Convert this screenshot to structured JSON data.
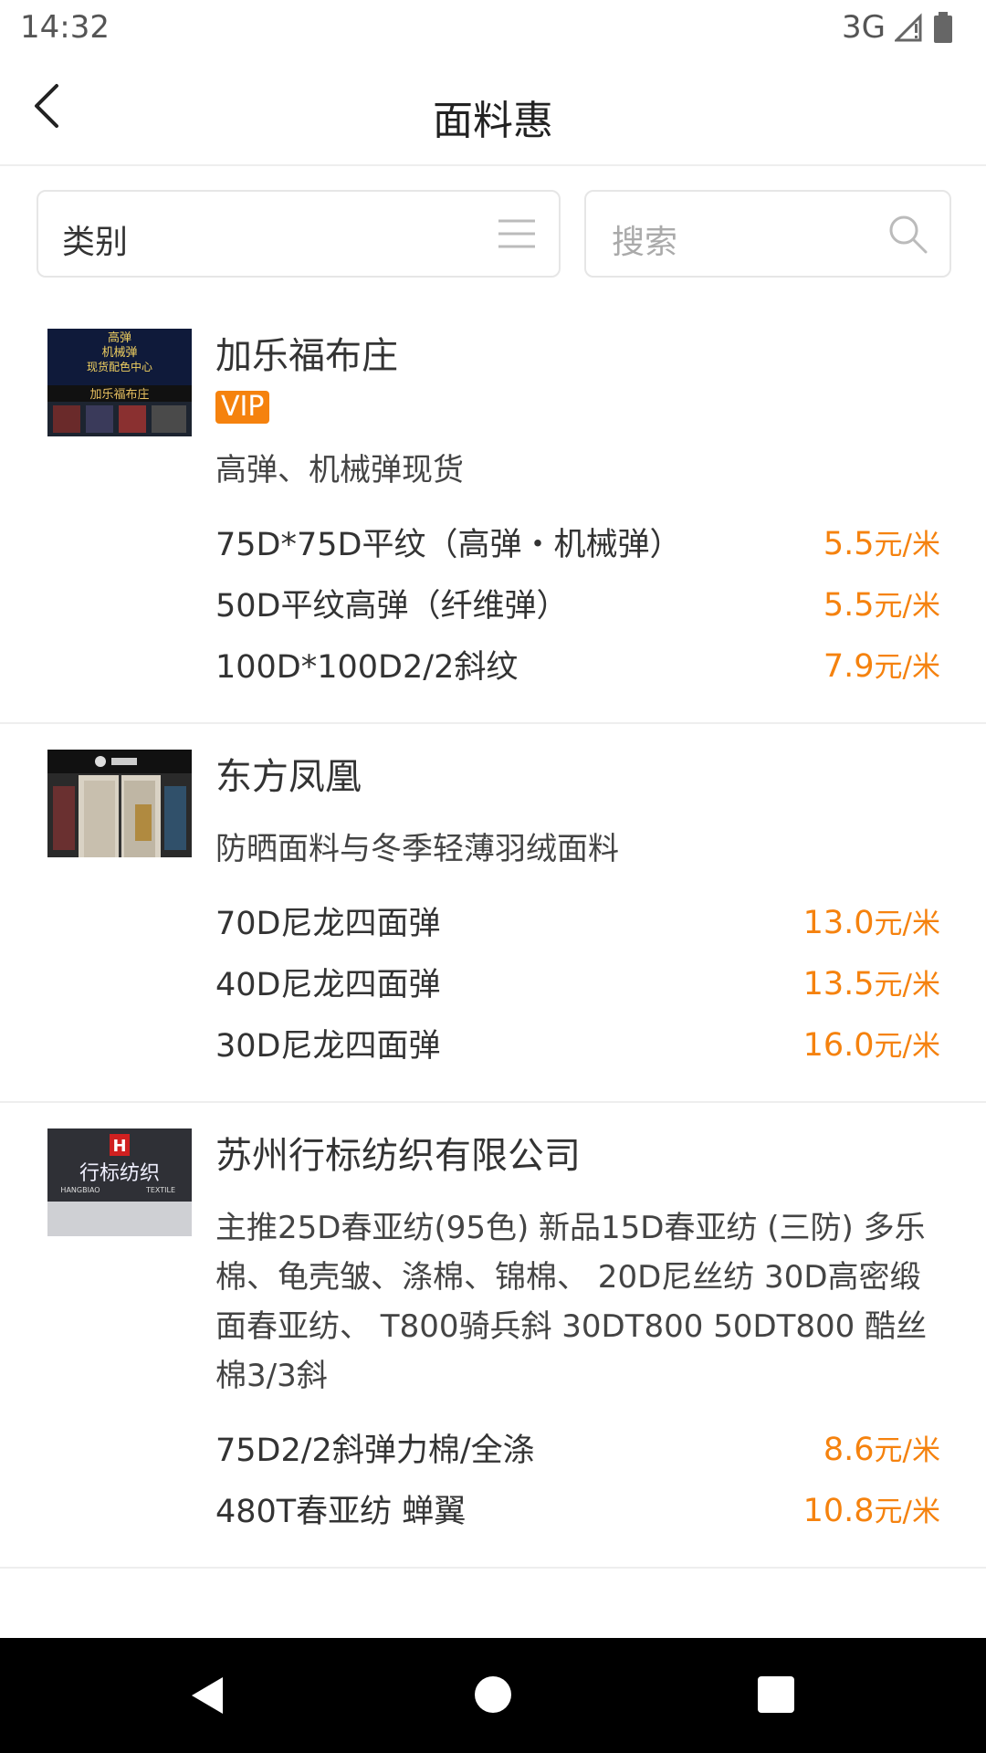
{
  "status_bar": {
    "time": "14:32",
    "network": "3G"
  },
  "header": {
    "title": "面料惠"
  },
  "filters": {
    "category_label": "类别",
    "search_placeholder": "搜索"
  },
  "stores": [
    {
      "name": "加乐福布庄",
      "badge": "VIP",
      "thumb_text": [
        "高弹",
        "机械弹",
        "现货配色中心",
        "加乐福布庄"
      ],
      "description": "高弹、机械弹现货",
      "products": [
        {
          "name": "75D*75D平纹（高弹・机械弹）",
          "price": "5.5",
          "unit": "元/米"
        },
        {
          "name": "50D平纹高弹（纤维弹）",
          "price": "5.5",
          "unit": "元/米"
        },
        {
          "name": "100D*100D2/2斜纹",
          "price": "7.9",
          "unit": "元/米"
        }
      ]
    },
    {
      "name": "东方凤凰",
      "description": "防晒面料与冬季轻薄羽绒面料",
      "products": [
        {
          "name": "70D尼龙四面弹",
          "price": "13.0",
          "unit": "元/米"
        },
        {
          "name": "40D尼龙四面弹",
          "price": "13.5",
          "unit": "元/米"
        },
        {
          "name": "30D尼龙四面弹",
          "price": "16.0",
          "unit": "元/米"
        }
      ]
    },
    {
      "name": "苏州行标纺织有限公司",
      "thumb_text": [
        "H",
        "行标纺织",
        "HANGBIAO",
        "TEXTILE"
      ],
      "description": "主推25D春亚纺(95色) 新品15D春亚纺 (三防) 多乐棉、龟壳皱、涤棉、锦棉、 20D尼丝纺 30D高密缎面春亚纺、 T800骑兵斜 30DT800 50DT800 酷丝棉3/3斜",
      "products": [
        {
          "name": "75D2/2斜弹力棉/全涤",
          "price": "8.6",
          "unit": "元/米"
        },
        {
          "name": "480T春亚纺 蝉翼",
          "price": "10.8",
          "unit": "元/米"
        }
      ]
    }
  ]
}
